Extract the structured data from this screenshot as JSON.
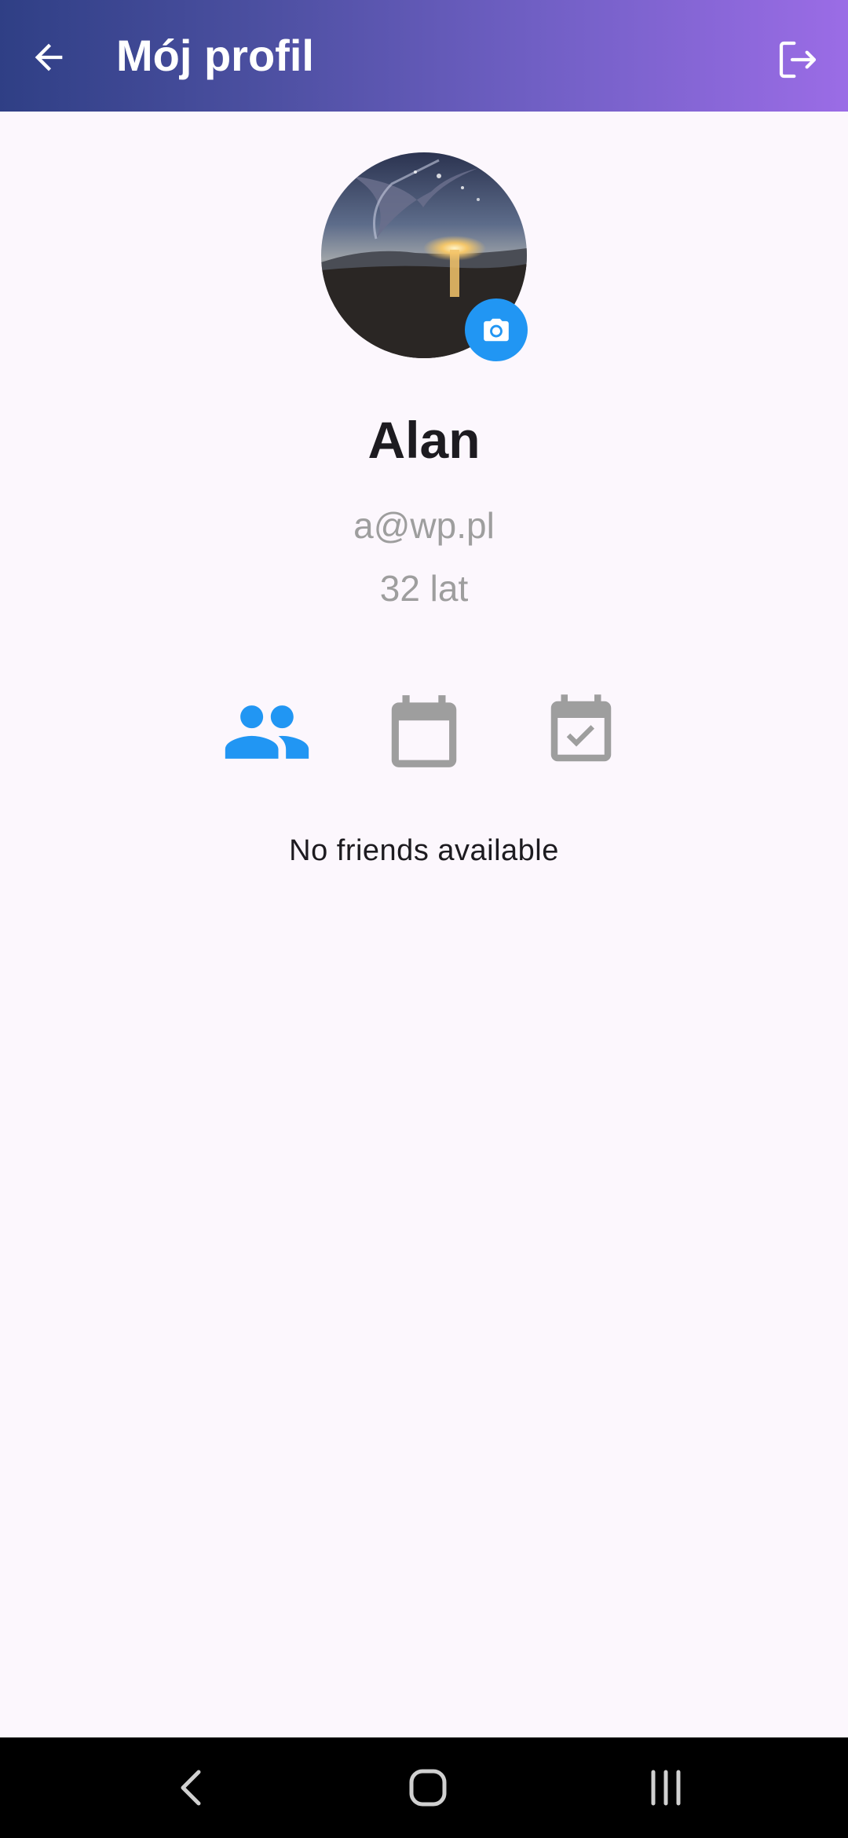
{
  "header": {
    "title": "Mój profil",
    "back_icon": "arrow-left-icon",
    "logout_icon": "logout-icon",
    "gradient": [
      "#2f3f85",
      "#9b6ce6"
    ]
  },
  "profile": {
    "avatar": "profile-photo",
    "camera_icon": "camera-icon",
    "name": "Alan",
    "email": "a@wp.pl",
    "age": "32 lat"
  },
  "tabs": [
    {
      "icon": "people-icon",
      "active": true
    },
    {
      "icon": "calendar-icon",
      "active": false
    },
    {
      "icon": "calendar-check-icon",
      "active": false
    }
  ],
  "content": {
    "empty_message": "No friends available"
  },
  "colors": {
    "accent": "#2196f3",
    "inactive_icon": "#9e9e9e",
    "background": "#fcf7fd"
  },
  "system_nav": {
    "icons": [
      "back-icon",
      "home-icon",
      "recents-icon"
    ]
  }
}
